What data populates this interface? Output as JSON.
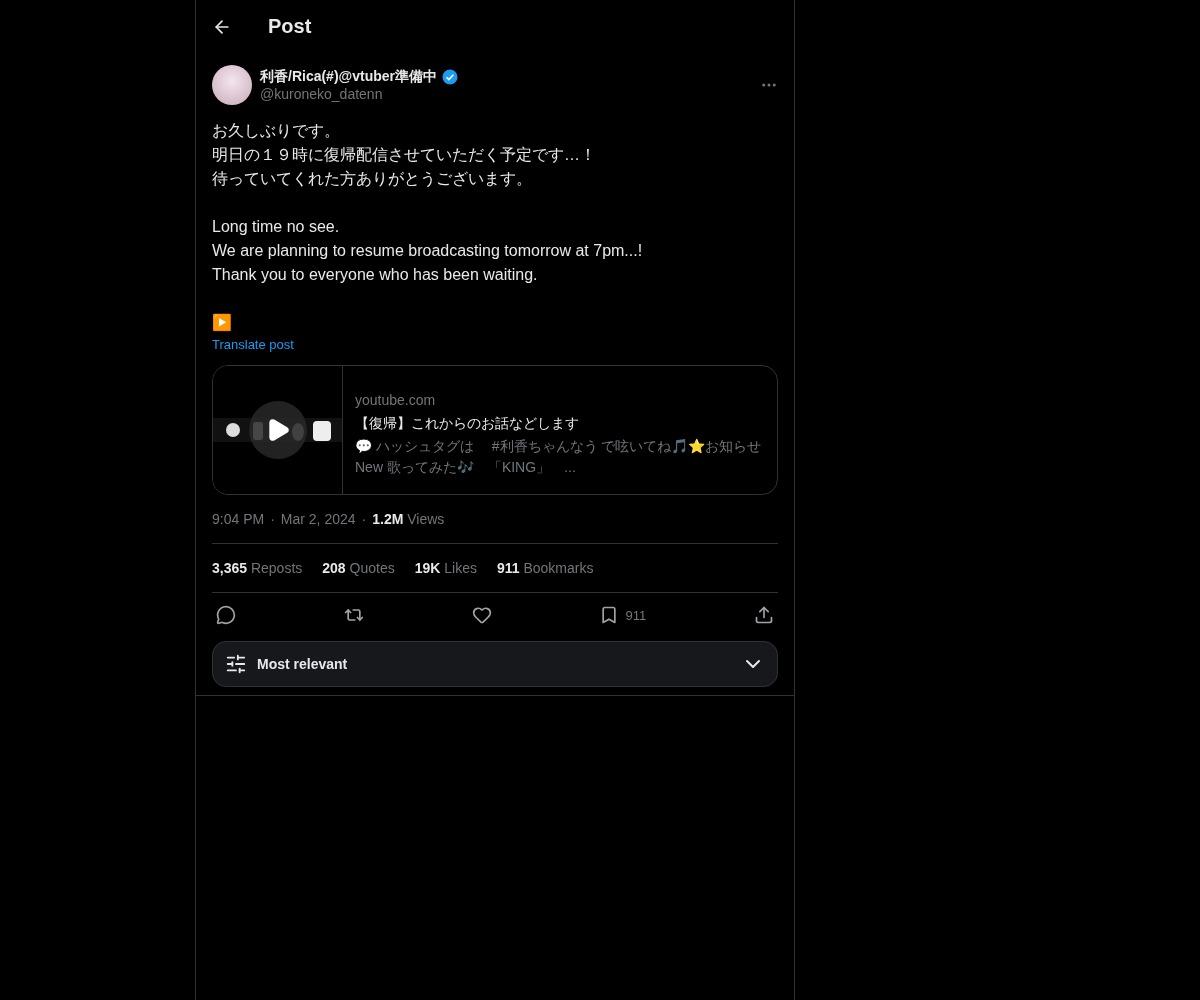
{
  "header": {
    "title": "Post"
  },
  "author": {
    "name": "利香/Rica(#)@vtuber準備中",
    "handle": "@kuroneko_datenn",
    "verified": true
  },
  "body": [
    [
      "お久しぶりです。",
      "明日の１９時に復帰配信させていただく予定です…！",
      "待っていてくれた方ありがとうございます。"
    ],
    [
      "Long time no see.",
      "We are planning to resume broadcasting tomorrow at 7pm...!",
      "Thank you to everyone who has been waiting."
    ],
    [
      "▶️"
    ]
  ],
  "translate_link": "Translate post",
  "link_card": {
    "domain": "youtube.com",
    "title": "【復帰】これからのお話などします",
    "description": "💬 ハッシュタグは　 #利香ちゃんなう で呟いてね🎵⭐お知らせ　New 歌ってみた🎶　「KING」　..."
  },
  "meta": {
    "time": "9:04 PM",
    "separator_1": "·",
    "date": "Mar 2, 2024",
    "separator_2": "·",
    "views_count": "1.2M",
    "views_label": "Views"
  },
  "stats": [
    {
      "count": "3,365",
      "label": "Reposts"
    },
    {
      "count": "208",
      "label": "Quotes"
    },
    {
      "count": "19K",
      "label": "Likes"
    },
    {
      "count": "911",
      "label": "Bookmarks"
    }
  ],
  "actions": [
    {
      "kind": "reply"
    },
    {
      "kind": "repost"
    },
    {
      "kind": "like"
    },
    {
      "kind": "bookmark",
      "count": "911"
    },
    {
      "kind": "share"
    }
  ],
  "sort": {
    "label": "Most relevant"
  }
}
